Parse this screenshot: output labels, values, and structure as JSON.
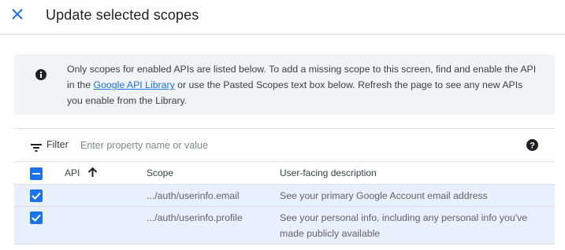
{
  "header": {
    "title": "Update selected scopes",
    "close_icon": "close-icon"
  },
  "info": {
    "icon": "info-icon",
    "text_before_link": "Only scopes for enabled APIs are listed below. To add a missing scope to this screen, find and enable the API in the ",
    "link_text": "Google API Library",
    "text_after_link": " or use the Pasted Scopes text box below. Refresh the page to see any new APIs you enable from the Library."
  },
  "filter": {
    "label": "Filter",
    "placeholder": "Enter property name or value",
    "value": ""
  },
  "table": {
    "columns": {
      "api": "API",
      "scope": "Scope",
      "description": "User-facing description"
    },
    "select_all_state": "indeterminate",
    "sort": {
      "column": "API",
      "direction": "ascending"
    },
    "rows": [
      {
        "checked": true,
        "api": "",
        "scope": ".../auth/userinfo.email",
        "description": "See your primary Google Account email address"
      },
      {
        "checked": true,
        "api": "",
        "scope": ".../auth/userinfo.profile",
        "description": "See your personal info, including any personal info you've made publicly available"
      }
    ]
  },
  "colors": {
    "accent": "#1a73e8",
    "info_bg": "#f1f3f4",
    "selected_row_bg": "#e8f0fe",
    "text_primary": "#202124",
    "text_secondary": "#5f6368"
  }
}
